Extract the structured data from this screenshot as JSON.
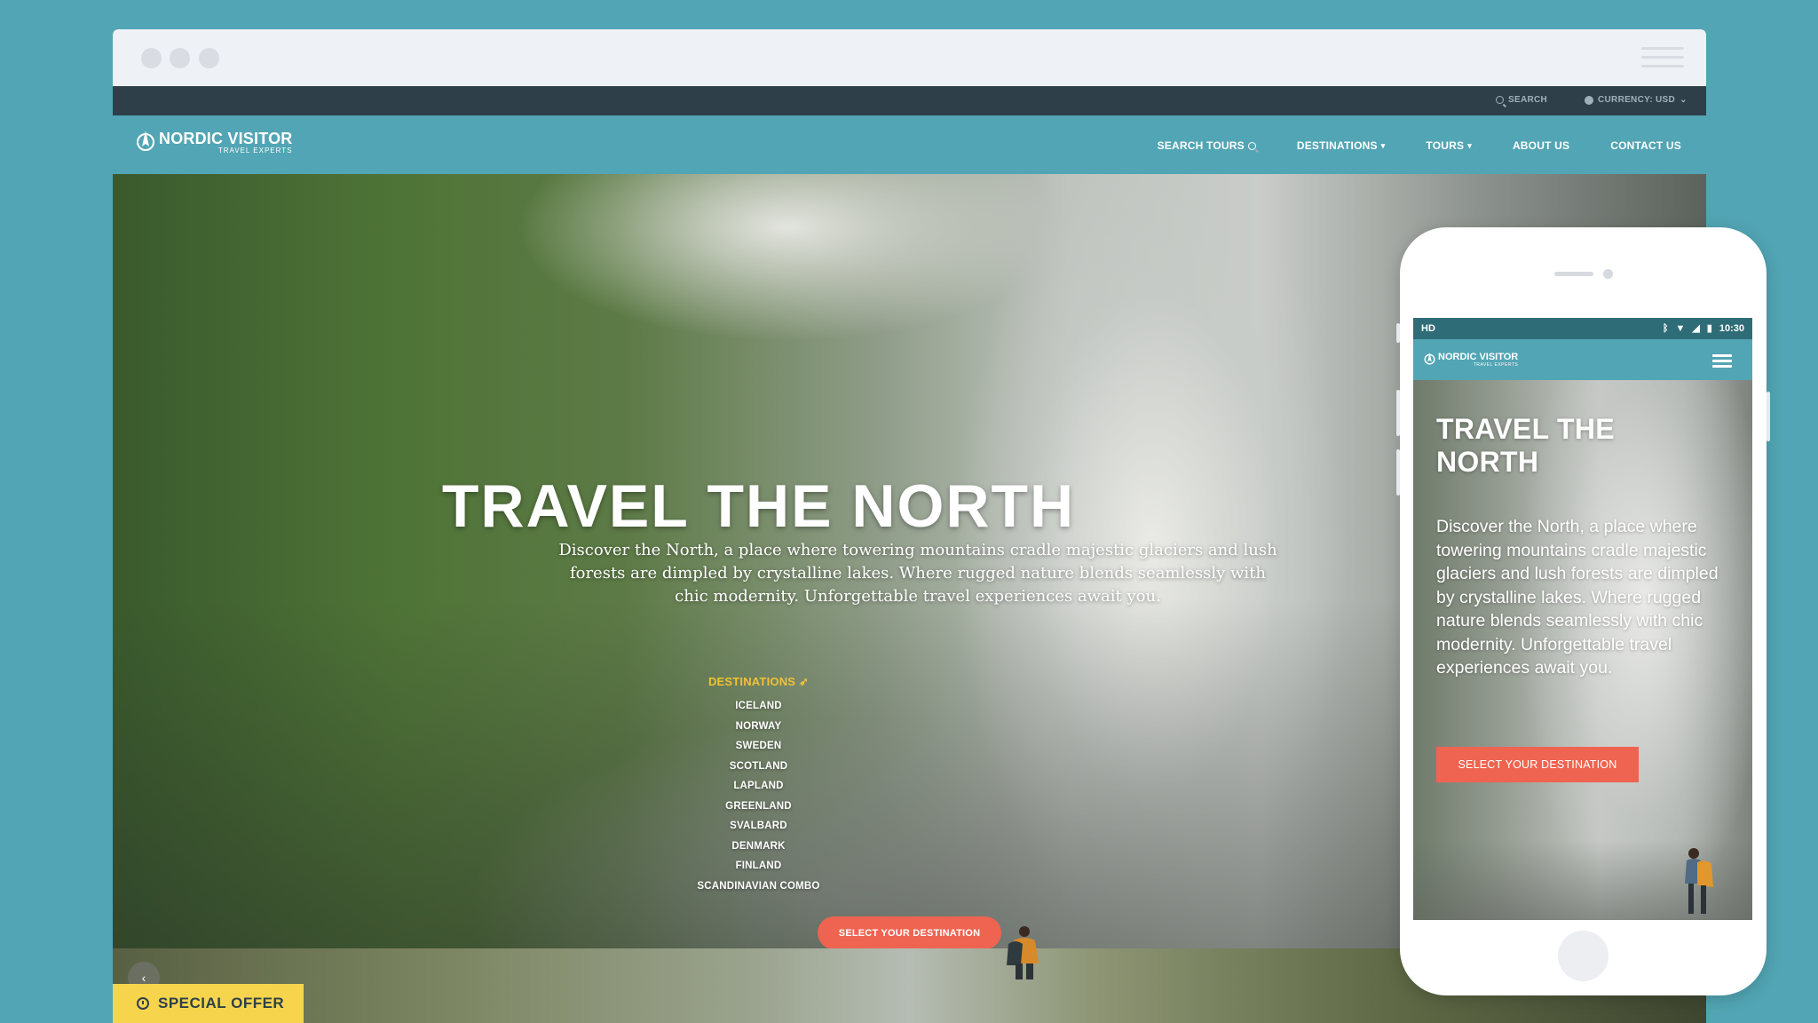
{
  "browser": {
    "topbar": {
      "search_label": "SEARCH",
      "currency_label": "CURRENCY: USD"
    },
    "nav": {
      "logo_title": "NORDIC VISITOR",
      "logo_subtitle": "TRAVEL EXPERTS",
      "items": [
        {
          "label": "SEARCH TOURS",
          "icon": "search-icon"
        },
        {
          "label": "DESTINATIONS",
          "icon": "chevron-down-icon"
        },
        {
          "label": "TOURS",
          "icon": "chevron-down-icon"
        },
        {
          "label": "ABOUT US"
        },
        {
          "label": "CONTACT US"
        }
      ]
    },
    "hero": {
      "title": "TRAVEL THE NORTH",
      "description": "Discover the North, a place where towering mountains cradle majestic glaciers and lush forests are dimpled by crystalline lakes. Where rugged nature blends seamlessly with chic modernity. Unforgettable travel experiences await you.",
      "destinations_heading": "DESTINATIONS",
      "destinations": [
        "ICELAND",
        "NORWAY",
        "SWEDEN",
        "SCOTLAND",
        "LAPLAND",
        "GREENLAND",
        "SVALBARD",
        "DENMARK",
        "FINLAND",
        "SCANDINAVIAN COMBO"
      ],
      "cta_label": "SELECT YOUR DESTINATION"
    },
    "special_offer_label": "SPECIAL OFFER"
  },
  "phone": {
    "status": {
      "hd": "HD",
      "time": "10:30"
    },
    "logo_title": "NORDIC VISITOR",
    "logo_subtitle": "TRAVEL EXPERTS",
    "hero_title": "TRAVEL THE NORTH",
    "hero_description": "Discover the North, a place where towering mountains cradle majestic glaciers and lush forests are dimpled by crystalline lakes. Where rugged nature blends seamlessly with chic modernity. Unforgettable travel experiences await you.",
    "cta_label": "SELECT YOUR DESTINATION"
  },
  "colors": {
    "background": "#52a5b4",
    "navbar": "#52a5b4",
    "topbar": "#2e3f4a",
    "cta": "#ee6450",
    "destinations_heading": "#f0c239",
    "special_offer": "#f6d54d"
  }
}
